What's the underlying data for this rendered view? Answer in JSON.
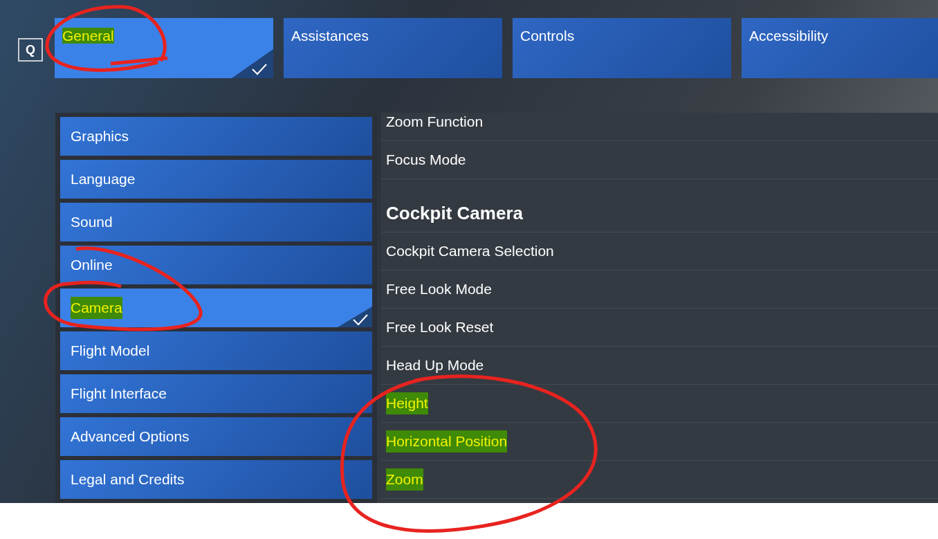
{
  "search_key": "Q",
  "tabs": [
    {
      "label": "General",
      "selected": true,
      "highlighted": true
    },
    {
      "label": "Assistances",
      "selected": false,
      "highlighted": false
    },
    {
      "label": "Controls",
      "selected": false,
      "highlighted": false
    },
    {
      "label": "Accessibility",
      "selected": false,
      "highlighted": false
    }
  ],
  "sidebar": {
    "items": [
      {
        "label": "Graphics",
        "selected": false,
        "highlighted": false
      },
      {
        "label": "Language",
        "selected": false,
        "highlighted": false
      },
      {
        "label": "Sound",
        "selected": false,
        "highlighted": false
      },
      {
        "label": "Online",
        "selected": false,
        "highlighted": false
      },
      {
        "label": "Camera",
        "selected": true,
        "highlighted": true
      },
      {
        "label": "Flight Model",
        "selected": false,
        "highlighted": false
      },
      {
        "label": "Flight Interface",
        "selected": false,
        "highlighted": false
      },
      {
        "label": "Advanced Options",
        "selected": false,
        "highlighted": false
      },
      {
        "label": "Legal and Credits",
        "selected": false,
        "highlighted": false
      }
    ]
  },
  "settings": [
    {
      "kind": "item",
      "label": "Zoom Function",
      "highlighted": false
    },
    {
      "kind": "item",
      "label": "Focus Mode",
      "highlighted": false
    },
    {
      "kind": "heading",
      "label": "Cockpit Camera",
      "highlighted": false
    },
    {
      "kind": "item",
      "label": "Cockpit Camera Selection",
      "highlighted": false
    },
    {
      "kind": "item",
      "label": "Free Look Mode",
      "highlighted": false
    },
    {
      "kind": "item",
      "label": "Free Look Reset",
      "highlighted": false
    },
    {
      "kind": "item",
      "label": "Head Up Mode",
      "highlighted": false
    },
    {
      "kind": "item",
      "label": "Height",
      "highlighted": true
    },
    {
      "kind": "item",
      "label": "Horizontal Position",
      "highlighted": true
    },
    {
      "kind": "item",
      "label": "Zoom",
      "highlighted": true
    }
  ]
}
